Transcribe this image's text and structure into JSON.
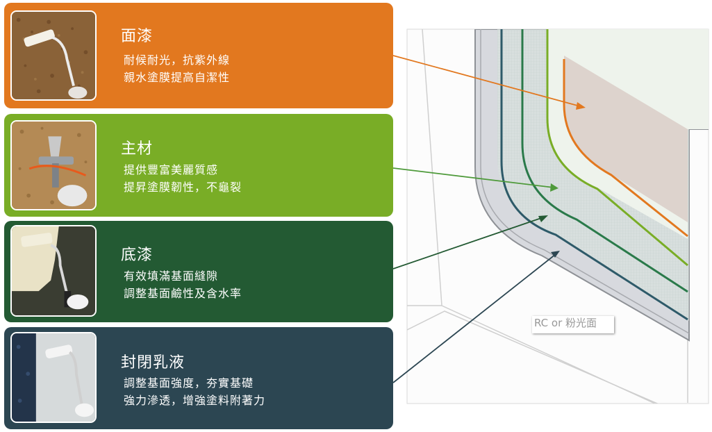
{
  "layers": [
    {
      "title": "面漆",
      "lines": [
        "耐候耐光，抗紫外線",
        "親水塗膜提高自潔性"
      ],
      "color": "#e2781f",
      "image": "roller-on-textured-wall"
    },
    {
      "title": "主材",
      "lines": [
        "提供豐富美麗質感",
        "提昇塗膜韌性，不龜裂"
      ],
      "color": "#79ad26",
      "image": "spray-gun"
    },
    {
      "title": "底漆",
      "lines": [
        "有效填滿基面縫隙",
        "調整基面鹼性及含水率"
      ],
      "color": "#235a33",
      "image": "roller-primer"
    },
    {
      "title": "封閉乳液",
      "lines": [
        "調整基面強度，夯實基礎",
        "強力滲透，增強塗料附著力"
      ],
      "color": "#2c4652",
      "image": "roller-sealer"
    }
  ],
  "substrate_label": "RC or 粉光面"
}
